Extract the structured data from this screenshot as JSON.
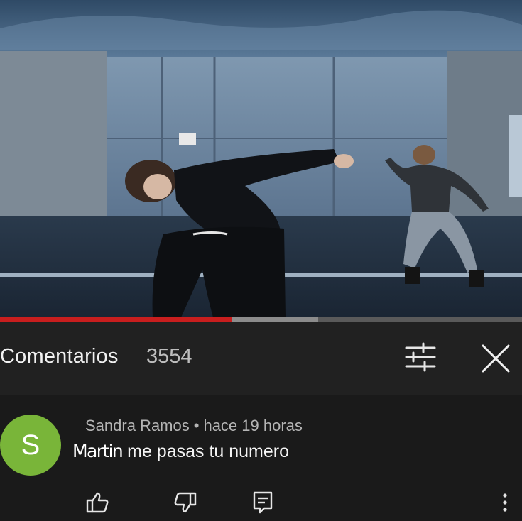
{
  "video": {
    "progress_fraction": 0.445,
    "buffered_fraction": 0.61
  },
  "header": {
    "title": "Comentarios",
    "count": "3554",
    "filter_icon": "sliders-icon",
    "close_icon": "close-icon"
  },
  "comment": {
    "avatar_letter": "S",
    "avatar_color": "#79b539",
    "author": "Sandra Ramos",
    "separator": "•",
    "time": "hace 19 horas",
    "mention": "Martin",
    "text": "me pasas tu numero",
    "actions": {
      "like_icon": "thumbs-up-icon",
      "dislike_icon": "thumbs-down-icon",
      "reply_icon": "reply-icon",
      "more_icon": "more-vertical-icon"
    }
  },
  "colors": {
    "background": "#212121",
    "comment_background": "#1a1a1a",
    "progress_red": "#c81e1e"
  }
}
